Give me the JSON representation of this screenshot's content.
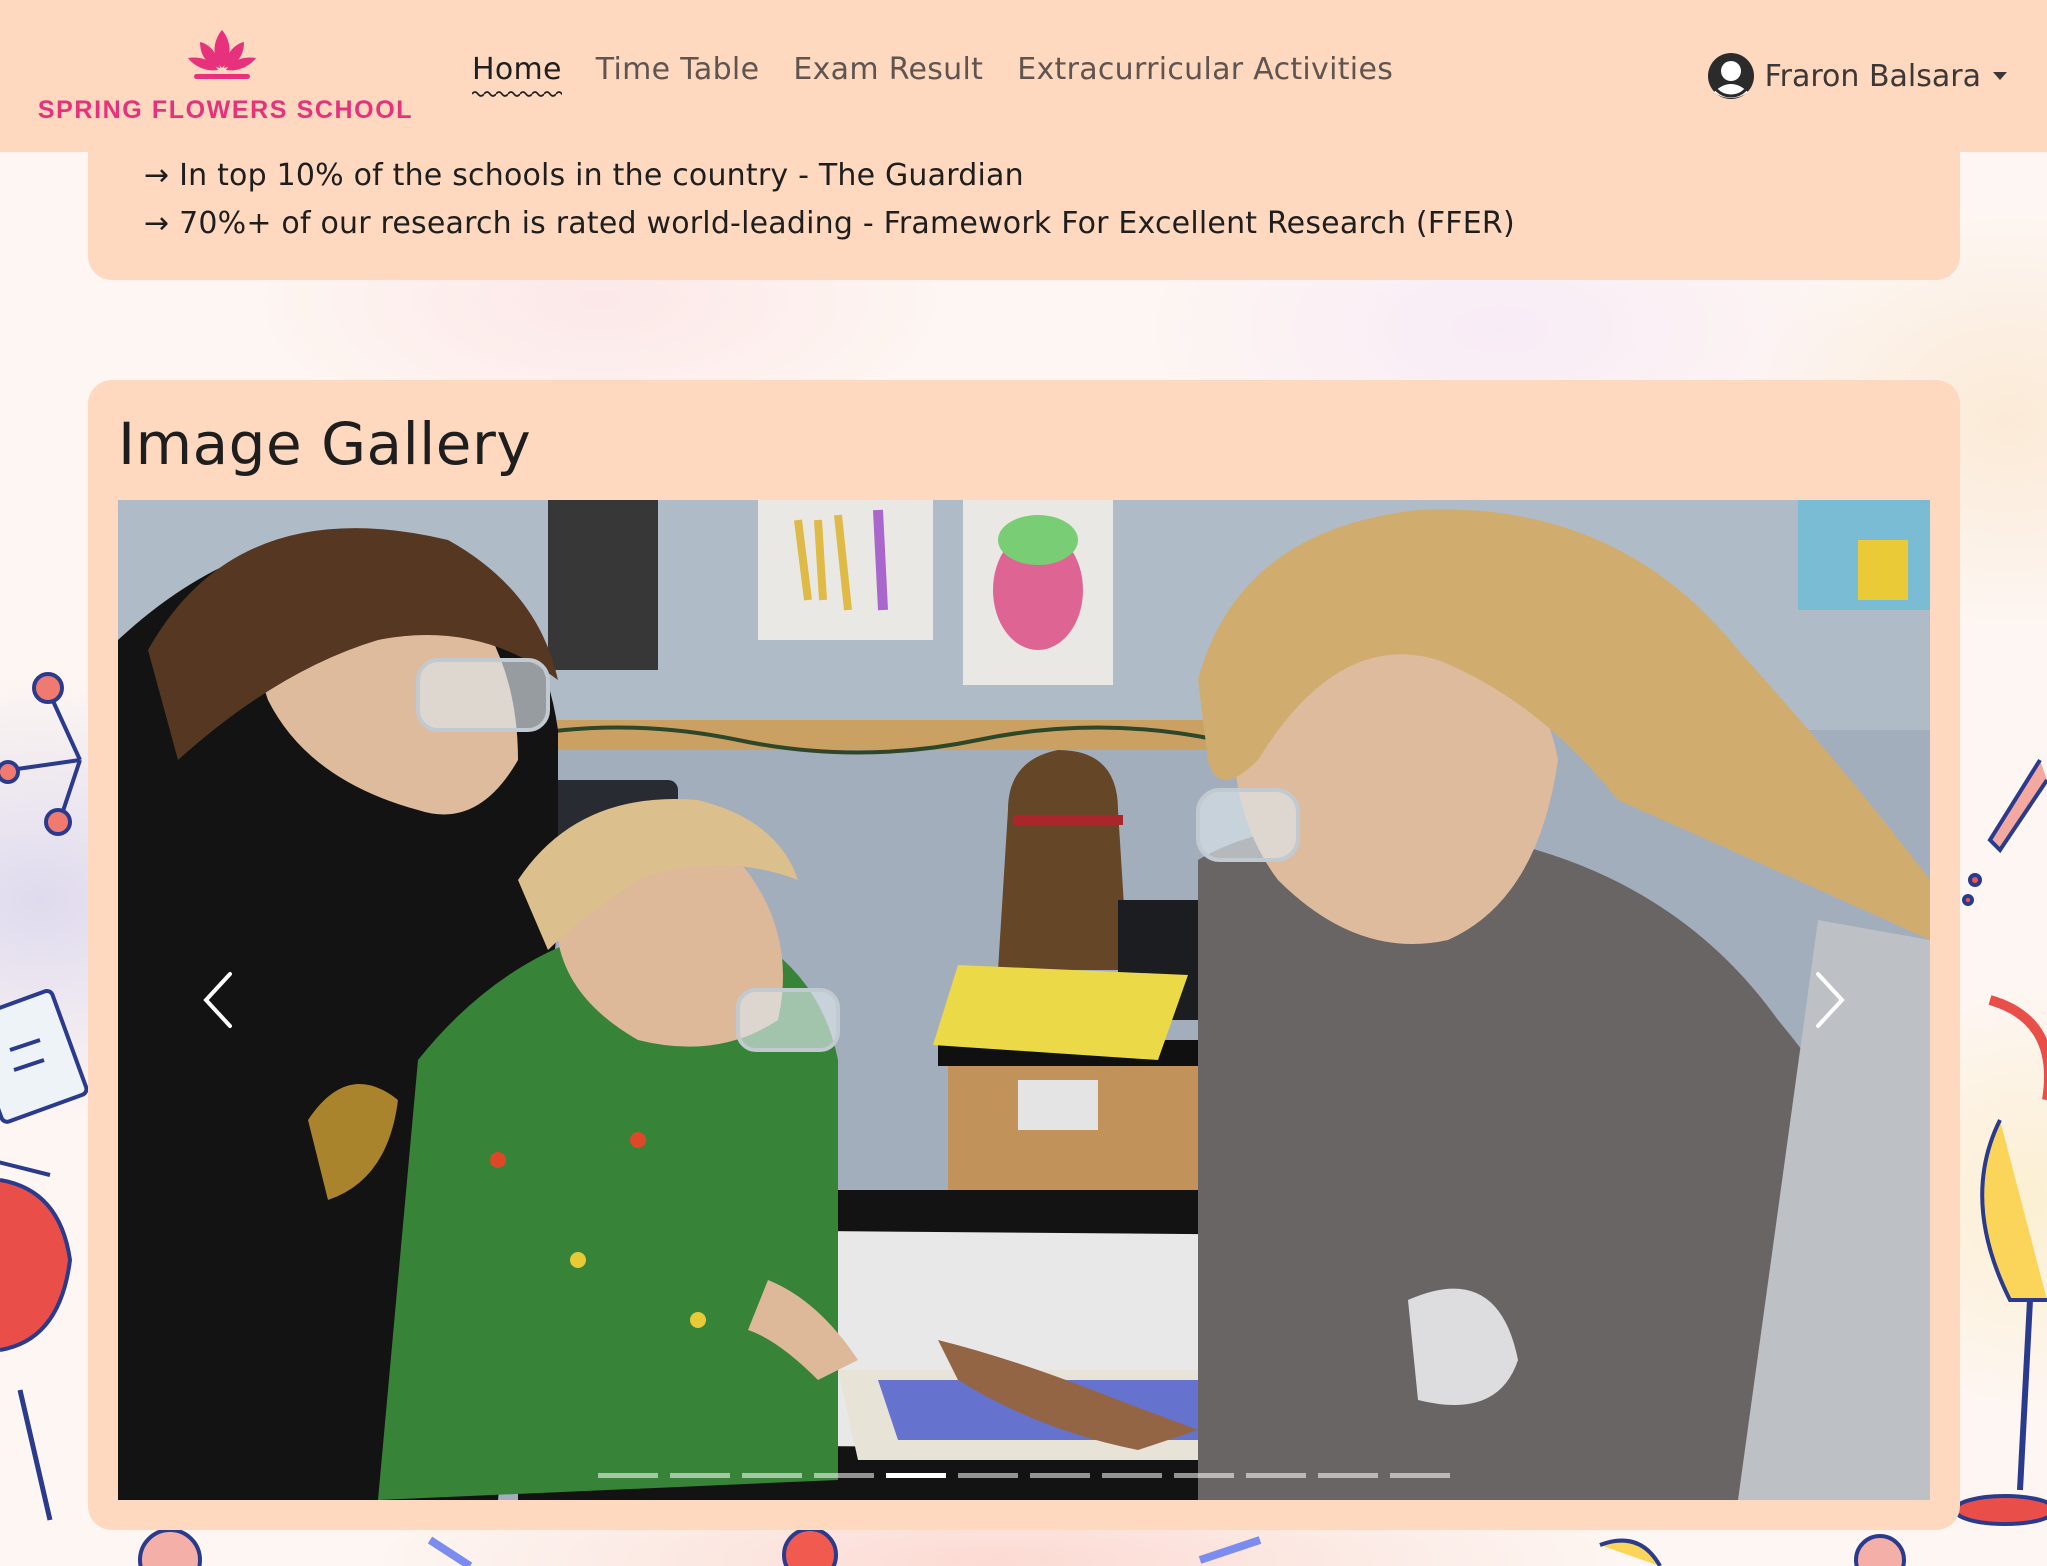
{
  "brand": {
    "name": "SPRING FLOWERS SCHOOL",
    "logo_icon": "lotus-icon",
    "color": "#e8317d"
  },
  "nav": {
    "links": [
      {
        "label": "Home",
        "active": true
      },
      {
        "label": "Time Table",
        "active": false
      },
      {
        "label": "Exam Result",
        "active": false
      },
      {
        "label": "Extracurricular Activities",
        "active": false
      }
    ],
    "user": {
      "name": "Fraron Balsara",
      "icon": "user-avatar-icon"
    }
  },
  "achievements": [
    "→ In top 10% of the schools in the country - The Guardian",
    "→ 70%+ of our research is rated world-leading - Framework For Excellent Research (FFER)"
  ],
  "gallery": {
    "title": "Image Gallery",
    "slide_count": 12,
    "active_slide": 5,
    "prev_icon": "chevron-left-icon",
    "next_icon": "chevron-right-icon"
  },
  "colors": {
    "card": "#fed8bf",
    "accent": "#e8317d",
    "text": "#1e1e1e"
  }
}
